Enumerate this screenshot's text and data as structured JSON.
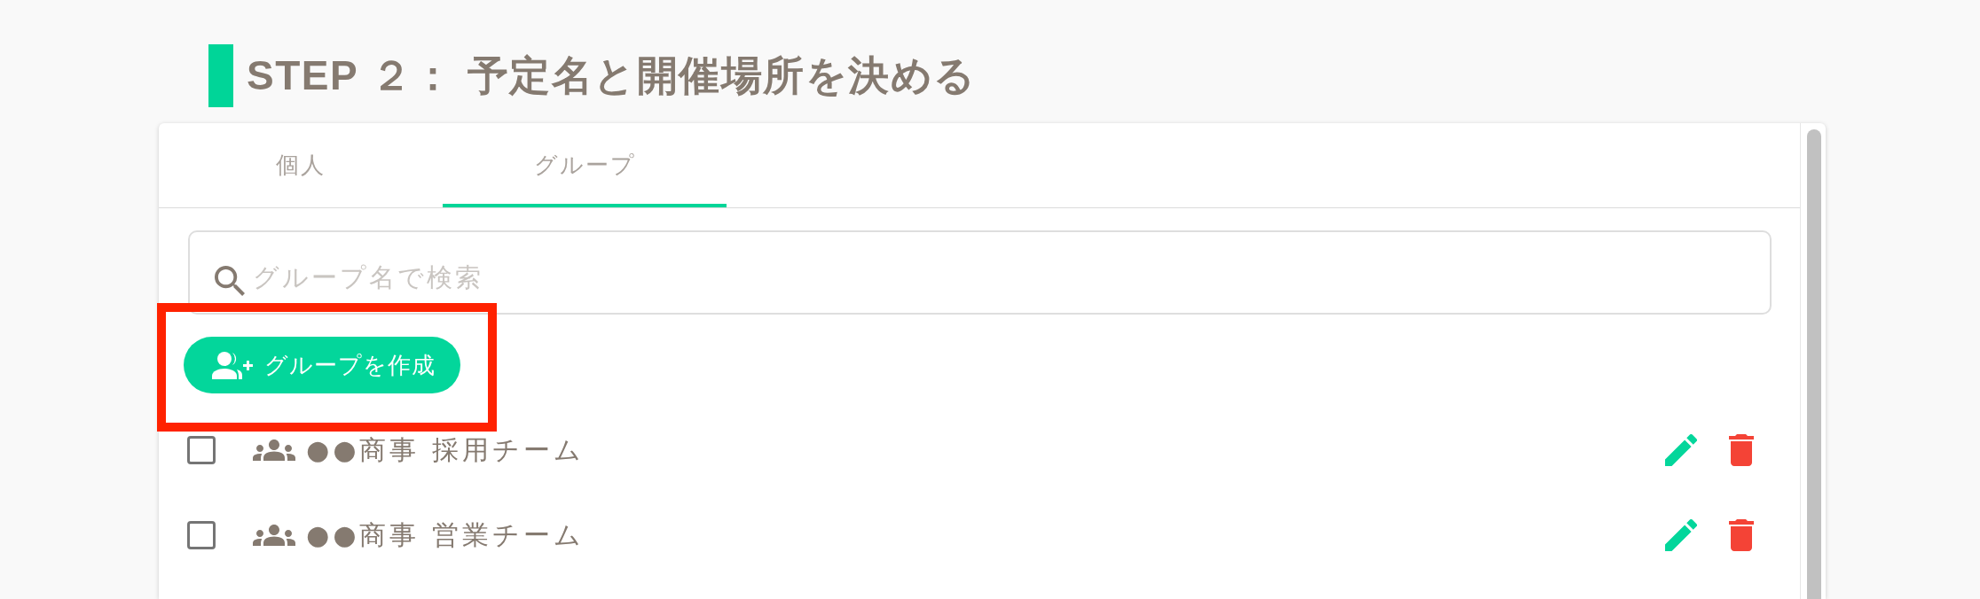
{
  "heading": {
    "text": "STEP ２： 予定名と開催場所を決める"
  },
  "tabs": [
    {
      "label": "個人",
      "selected": false
    },
    {
      "label": "グループ",
      "selected": true
    }
  ],
  "search": {
    "placeholder": "グループ名で検索"
  },
  "create_button": {
    "label": "グループを作成",
    "highlighted": true
  },
  "groups": [
    {
      "name": "●●商事 採用チーム",
      "checked": false
    },
    {
      "name": "●●商事 営業チーム",
      "checked": false
    }
  ]
}
